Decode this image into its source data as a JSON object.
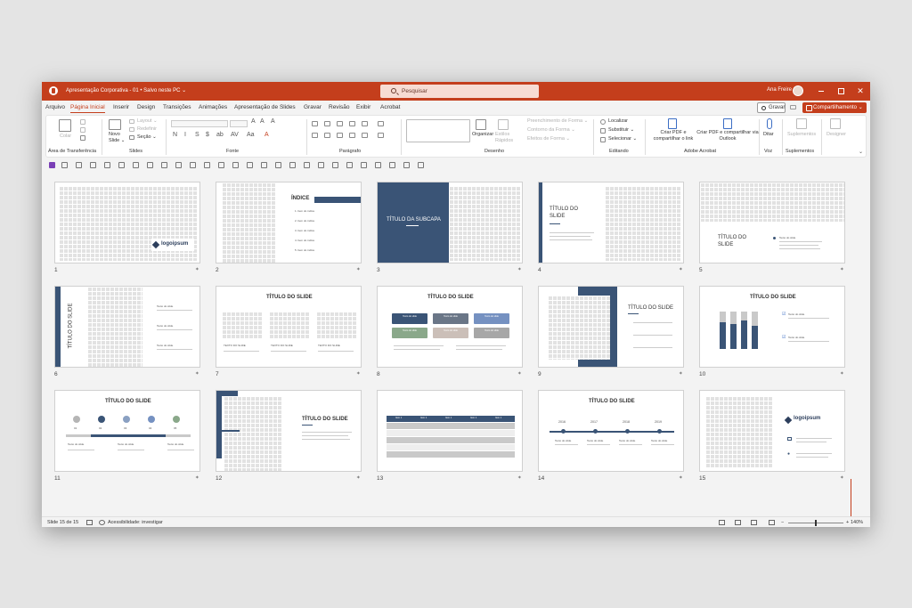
{
  "titlebar": {
    "doc_title": "Apresentação Corporativa - 01 • Salvo neste PC ⌄",
    "search_placeholder": "Pesquisar",
    "user_name": "Ana Freire",
    "close_glyph": "✕"
  },
  "tabs": [
    "Arquivo",
    "Página Inicial",
    "Inserir",
    "Design",
    "Transições",
    "Animações",
    "Apresentação de Slides",
    "Gravar",
    "Revisão",
    "Exibir",
    "Acrobat"
  ],
  "active_tab": "Página Inicial",
  "actions": {
    "gravar": "Gravar",
    "share": "Compartilhamento ⌄"
  },
  "ribbon": {
    "groups": [
      "Área de Transferência",
      "Slides",
      "Fonte",
      "Parágrafo",
      "Desenho",
      "Editando",
      "Adobe Acrobat",
      "Voz",
      "Suplementos"
    ],
    "colar": "Colar",
    "novo_slide": "Novo Slide ⌄",
    "layout": "Layout ⌄",
    "redefinir": "Redefinir",
    "secao": "Seção ⌄",
    "organizar": "Organizar",
    "estilos_rapidos": "Estilos Rápidos",
    "preenchimento": "Preenchimento de Forma ⌄",
    "contorno": "Contorno da Forma ⌄",
    "efeitos": "Efeitos de Forma ⌄",
    "localizar": "Localizar",
    "substituir": "Substituir ⌄",
    "selecionar": "Selecionar ⌄",
    "criar_pdf_link": "Criar PDF e compartilhar o link",
    "criar_pdf_outlook": "Criar PDF e compartilhar via Outlook",
    "ditar": "Ditar",
    "suplementos": "Suplementos",
    "designer": "Designer",
    "font_buttons": [
      "N",
      "I",
      "S",
      "$",
      "ab",
      "AV",
      "Aa",
      "A"
    ]
  },
  "slides": [
    {
      "num": "1",
      "logo": "logoipsum"
    },
    {
      "num": "2",
      "title": "ÍNDICE",
      "items": [
        "1.  Item do índice",
        "2.  Item do índice",
        "3.  Item do índice",
        "4.  Item do índice",
        "5.  Item do índice"
      ]
    },
    {
      "num": "3",
      "title": "TÍTULO DA SUBCAPA"
    },
    {
      "num": "4",
      "title": "TÍTULO DO SLIDE"
    },
    {
      "num": "5",
      "title": "TÍTULO DO SLIDE",
      "sub": "Texto do slide"
    },
    {
      "num": "6",
      "title": "TÍTULO DO SLIDE",
      "sub": "Texto do slide"
    },
    {
      "num": "7",
      "title": "TÍTULO DO SLIDE",
      "sub": "TEXTO DO SLIDE"
    },
    {
      "num": "8",
      "title": "TÍTULO DO SLIDE",
      "sub": "Texto do slide"
    },
    {
      "num": "9",
      "title": "TÍTULO DO SLIDE"
    },
    {
      "num": "10",
      "title": "TÍTULO DO SLIDE",
      "sub": "Texto do slide"
    },
    {
      "num": "11",
      "title": "TÍTULO DO SLIDE",
      "steps": [
        "01",
        "02",
        "03",
        "04",
        "05"
      ],
      "sub": "Texto do slide"
    },
    {
      "num": "12",
      "title": "TÍTULO DO SLIDE"
    },
    {
      "num": "13",
      "header": "Item 1"
    },
    {
      "num": "14",
      "title": "TÍTULO DO SLIDE",
      "years": [
        "2016",
        "2017",
        "2018",
        "2019"
      ],
      "sub": "Texto do slide"
    },
    {
      "num": "15",
      "logo": "logoipsum"
    }
  ],
  "status": {
    "slide_count": "Slide 15 de 15",
    "accessibility": "Acessibilidade: investigar",
    "zoom": "140%"
  },
  "colors": {
    "accent": "#c43e1c",
    "navy": "#3a5476"
  }
}
